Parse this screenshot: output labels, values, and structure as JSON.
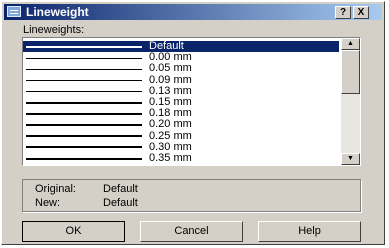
{
  "window": {
    "title": "Lineweight",
    "help_label": "?",
    "close_label": "X"
  },
  "list": {
    "label": "Lineweights:",
    "items": [
      {
        "label": "Default",
        "weight_mm": 0.25,
        "selected": true
      },
      {
        "label": "0.00 mm",
        "weight_mm": 0.0,
        "selected": false
      },
      {
        "label": "0.05 mm",
        "weight_mm": 0.05,
        "selected": false
      },
      {
        "label": "0.09 mm",
        "weight_mm": 0.09,
        "selected": false
      },
      {
        "label": "0.13 mm",
        "weight_mm": 0.13,
        "selected": false
      },
      {
        "label": "0.15 mm",
        "weight_mm": 0.15,
        "selected": false
      },
      {
        "label": "0.18 mm",
        "weight_mm": 0.18,
        "selected": false
      },
      {
        "label": "0.20 mm",
        "weight_mm": 0.2,
        "selected": false
      },
      {
        "label": "0.25 mm",
        "weight_mm": 0.25,
        "selected": false
      },
      {
        "label": "0.30 mm",
        "weight_mm": 0.3,
        "selected": false
      },
      {
        "label": "0.35 mm",
        "weight_mm": 0.35,
        "selected": false
      }
    ],
    "scroll_up_icon": "arrow-up-icon",
    "scroll_down_icon": "arrow-down-icon",
    "scroll_position": 0
  },
  "info": {
    "original_label": "Original:",
    "original_value": "Default",
    "new_label": "New:",
    "new_value": "Default"
  },
  "buttons": {
    "ok": "OK",
    "cancel": "Cancel",
    "help": "Help"
  },
  "colors": {
    "title_start": "#0a246a",
    "title_end": "#a6caf0",
    "selection": "#0a246a",
    "face": "#d4d0c8"
  }
}
